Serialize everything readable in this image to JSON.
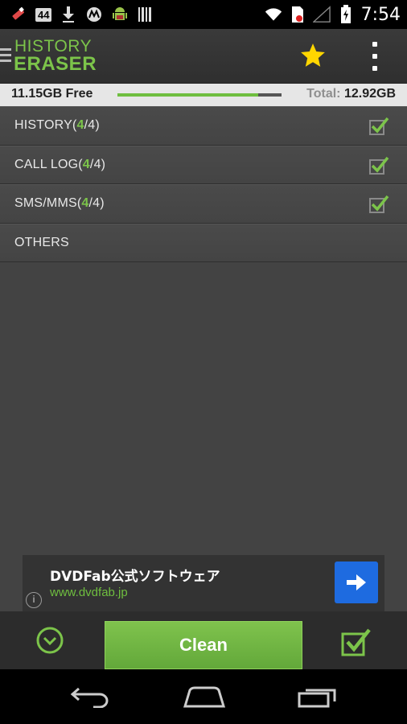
{
  "status_bar": {
    "notification_count": "44",
    "time": "7:54",
    "icons": [
      "usb-debug-icon",
      "download-icon",
      "motorola-icon",
      "android-icon",
      "barcode-icon",
      "wifi-icon",
      "no-sim-icon",
      "signal-icon",
      "battery-icon"
    ]
  },
  "app_bar": {
    "logo_line1": "HISTORY",
    "logo_line2": "ERASER",
    "star_color": "#ffd600"
  },
  "storage": {
    "free": "11.15GB Free",
    "total_label": "Total:",
    "total_value": "12.92GB",
    "used_fraction": 0.86
  },
  "categories": [
    {
      "name": "HISTORY",
      "selected": "4",
      "total": "4",
      "checked": true
    },
    {
      "name": "CALL LOG",
      "selected": "4",
      "total": "4",
      "checked": true
    },
    {
      "name": "SMS/MMS",
      "selected": "4",
      "total": "4",
      "checked": true
    },
    {
      "name": "OTHERS",
      "selected": null,
      "total": null,
      "checked": false
    }
  ],
  "ad": {
    "title": "DVDFab公式ソフトウェア",
    "url": "www.dvdfab.jp",
    "info": "i"
  },
  "toolbar": {
    "clean_label": "Clean"
  },
  "colors": {
    "accent_green": "#7cc44a",
    "ad_button_blue": "#1e6be0"
  }
}
